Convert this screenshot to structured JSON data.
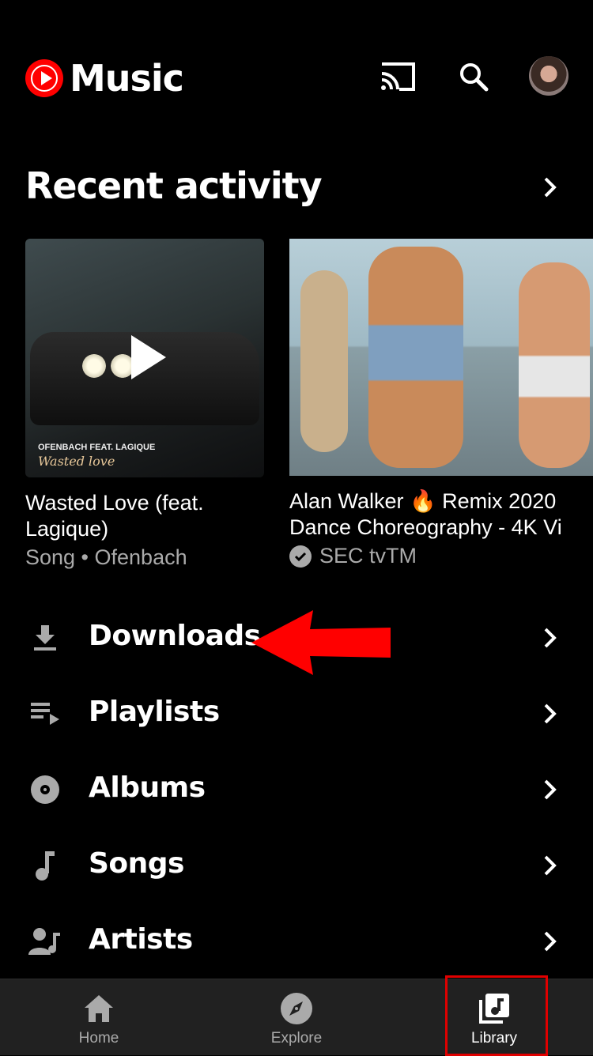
{
  "header": {
    "logo_text": "Music",
    "cast_icon": "cast-icon",
    "search_icon": "search-icon",
    "avatar": "avatar"
  },
  "recent": {
    "title": "Recent activity",
    "cards": [
      {
        "title_line1": "Wasted Love (feat.",
        "title_line2": "Lagique)",
        "subtitle": "Song • Ofenbach",
        "art_line1": "OFENBACH FEAT. LAGIQUE",
        "art_line2": "Wasted love"
      },
      {
        "title_line1": "Alan Walker 🔥 Remix 2020",
        "title_line2": "Dance Choreography - 4K Vi",
        "subtitle": "SEC tvTM"
      }
    ]
  },
  "menu": {
    "items": [
      {
        "label": "Downloads",
        "icon": "download-icon"
      },
      {
        "label": "Playlists",
        "icon": "playlist-icon"
      },
      {
        "label": "Albums",
        "icon": "album-icon"
      },
      {
        "label": "Songs",
        "icon": "music-note-icon"
      },
      {
        "label": "Artists",
        "icon": "artist-icon"
      }
    ]
  },
  "nav": {
    "items": [
      {
        "label": "Home",
        "icon": "home-icon",
        "active": false
      },
      {
        "label": "Explore",
        "icon": "compass-icon",
        "active": false
      },
      {
        "label": "Library",
        "icon": "library-icon",
        "active": true
      }
    ]
  },
  "colors": {
    "brand_red": "#ff0000",
    "annotation_red": "#e00000",
    "nav_bg": "#212121",
    "secondary_text": "#aaaaaa"
  }
}
